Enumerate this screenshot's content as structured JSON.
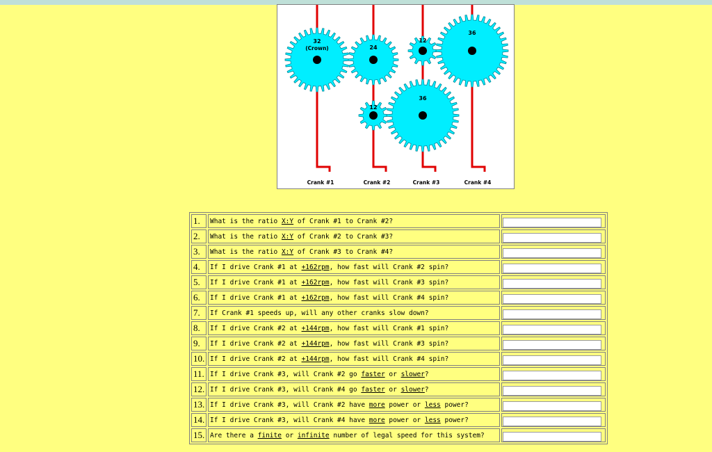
{
  "diagram": {
    "colors": {
      "gear_fill": "#00eeff",
      "gear_stroke": "#008899",
      "shaft": "#e00000",
      "hub": "#000000"
    },
    "gears": [
      {
        "id": "crown",
        "teeth_label": "32",
        "sub_label": "(Crown)"
      },
      {
        "id": "g24",
        "teeth_label": "24"
      },
      {
        "id": "g12top",
        "teeth_label": "12"
      },
      {
        "id": "g36top",
        "teeth_label": "36"
      },
      {
        "id": "g12bot",
        "teeth_label": "12"
      },
      {
        "id": "g36bot",
        "teeth_label": "36"
      }
    ],
    "crank_labels": [
      "Crank #1",
      "Crank #2",
      "Crank #3",
      "Crank #4"
    ]
  },
  "questions": [
    {
      "num": "1.",
      "parts": [
        "What is the ratio ",
        {
          "u": "X:Y"
        },
        " of Crank #1 to Crank #2?"
      ],
      "answer": ""
    },
    {
      "num": "2.",
      "parts": [
        "What is the ratio ",
        {
          "u": "X:Y"
        },
        " of Crank #2 to Crank #3?"
      ],
      "answer": ""
    },
    {
      "num": "3.",
      "parts": [
        "What is the ratio ",
        {
          "u": "X:Y"
        },
        " of Crank #3 to Crank #4?"
      ],
      "answer": ""
    },
    {
      "num": "4.",
      "parts": [
        "If I drive Crank #1 at ",
        {
          "u": "+162rpm"
        },
        ", how fast will Crank #2 spin?"
      ],
      "answer": ""
    },
    {
      "num": "5.",
      "parts": [
        "If I drive Crank #1 at ",
        {
          "u": "+162rpm"
        },
        ", how fast will Crank #3 spin?"
      ],
      "answer": ""
    },
    {
      "num": "6.",
      "parts": [
        "If I drive Crank #1 at ",
        {
          "u": "+162rpm"
        },
        ", how fast will Crank #4 spin?"
      ],
      "answer": ""
    },
    {
      "num": "7.",
      "parts": [
        "If Crank #1 speeds up, will any other cranks slow down?"
      ],
      "answer": ""
    },
    {
      "num": "8.",
      "parts": [
        "If I drive Crank #2 at ",
        {
          "u": "+144rpm"
        },
        ", how fast will Crank #1 spin?"
      ],
      "answer": ""
    },
    {
      "num": "9.",
      "parts": [
        "If I drive Crank #2 at ",
        {
          "u": "+144rpm"
        },
        ", how fast will Crank #3 spin?"
      ],
      "answer": ""
    },
    {
      "num": "10.",
      "parts": [
        "If I drive Crank #2 at ",
        {
          "u": "+144rpm"
        },
        ", how fast will Crank #4 spin?"
      ],
      "answer": ""
    },
    {
      "num": "11.",
      "parts": [
        "If I drive Crank #3, will Crank #2 go ",
        {
          "u": "faster"
        },
        " or ",
        {
          "u": "slower"
        },
        "?"
      ],
      "answer": ""
    },
    {
      "num": "12.",
      "parts": [
        "If I drive Crank #3, will Crank #4 go ",
        {
          "u": "faster"
        },
        " or ",
        {
          "u": "slower"
        },
        "?"
      ],
      "answer": ""
    },
    {
      "num": "13.",
      "parts": [
        "If I drive Crank #3, will Crank #2 have ",
        {
          "u": "more"
        },
        " power or ",
        {
          "u": "less"
        },
        " power?"
      ],
      "answer": ""
    },
    {
      "num": "14.",
      "parts": [
        "If I drive Crank #3, will Crank #4 have ",
        {
          "u": "more"
        },
        " power or ",
        {
          "u": "less"
        },
        " power?"
      ],
      "answer": ""
    },
    {
      "num": "15.",
      "parts": [
        "Are there a ",
        {
          "u": "finite"
        },
        " or ",
        {
          "u": "infinite"
        },
        " number of legal speed for this system?"
      ],
      "answer": ""
    }
  ]
}
